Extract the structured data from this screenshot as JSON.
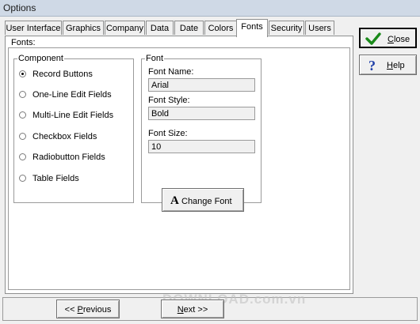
{
  "window": {
    "title": "Options"
  },
  "tabs": [
    {
      "label": "User Interface",
      "active": false
    },
    {
      "label": "Graphics",
      "active": false
    },
    {
      "label": "Company",
      "active": false
    },
    {
      "label": "Data",
      "active": false
    },
    {
      "label": "Date",
      "active": false
    },
    {
      "label": "Colors",
      "active": false
    },
    {
      "label": "Fonts",
      "active": true
    },
    {
      "label": "Security",
      "active": false
    },
    {
      "label": "Users",
      "active": false
    }
  ],
  "panel": {
    "label": "Fonts:"
  },
  "component_group": {
    "title": "Component",
    "options": [
      {
        "label": "Record Buttons",
        "checked": true
      },
      {
        "label": "One-Line Edit Fields",
        "checked": false
      },
      {
        "label": "Multi-Line Edit Fields",
        "checked": false
      },
      {
        "label": "Checkbox Fields",
        "checked": false
      },
      {
        "label": "Radiobutton Fields",
        "checked": false
      },
      {
        "label": "Table Fields",
        "checked": false
      }
    ]
  },
  "font_group": {
    "title": "Font",
    "name_label": "Font Name:",
    "name_value": "Arial",
    "style_label": "Font Style:",
    "style_value": "Bold",
    "size_label": "Font Size:",
    "size_value": "10",
    "change_button": {
      "glyph": "A",
      "label": "Change Font"
    }
  },
  "side_buttons": {
    "close": {
      "first": "C",
      "rest": "lose",
      "icon": "check-icon"
    },
    "help": {
      "first": "H",
      "rest": "elp",
      "icon": "question-icon"
    }
  },
  "nav": {
    "previous": {
      "prefix": "<< ",
      "first": "P",
      "rest": "revious"
    },
    "next": {
      "first": "N",
      "rest": "ext",
      "suffix": " >>"
    }
  },
  "watermark": "DOWNLOAD.com.vn",
  "colors": {
    "check": "#1a8a1a",
    "help": "#1f3fa8"
  }
}
